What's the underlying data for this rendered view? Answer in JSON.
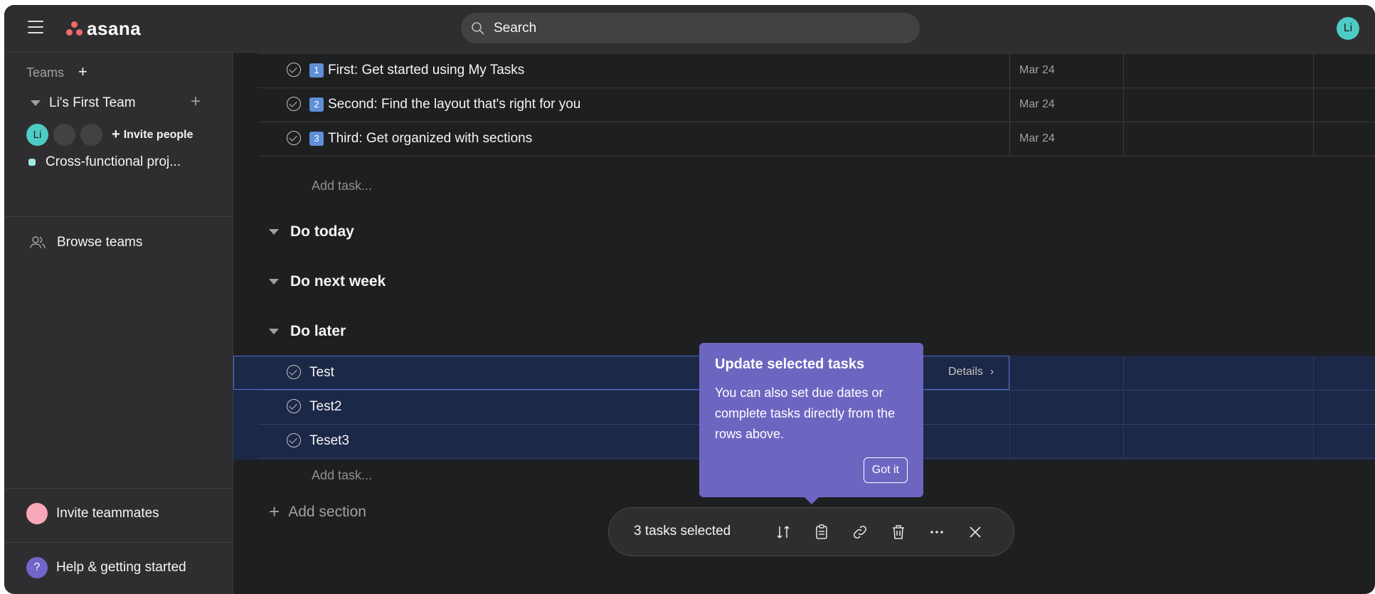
{
  "app": {
    "name": "asana"
  },
  "search": {
    "label": "Search"
  },
  "user": {
    "initials": "Li"
  },
  "sidebar": {
    "teams_label": "Teams",
    "team_name": "Li's First Team",
    "member_initials": "Li",
    "invite_people": "Invite people",
    "project_name": "Cross-functional proj...",
    "browse_teams": "Browse teams",
    "invite_teammates": "Invite teammates",
    "help": "Help & getting started",
    "help_icon": "?"
  },
  "tasks": [
    {
      "emoji": "1",
      "name": "First: Get started using My Tasks",
      "date": "Mar 24"
    },
    {
      "emoji": "2",
      "name": "Second: Find the layout that's right for you",
      "date": "Mar 24"
    },
    {
      "emoji": "3",
      "name": "Third: Get organized with sections",
      "date": "Mar 24"
    }
  ],
  "add_task": "Add task...",
  "sections": [
    "Do today",
    "Do next week",
    "Do later"
  ],
  "later_tasks": [
    {
      "name": "Test"
    },
    {
      "name": "Test2"
    },
    {
      "name": "Teset3"
    }
  ],
  "details_label": "Details",
  "add_section": "Add section",
  "tooltip": {
    "title": "Update selected tasks",
    "body": "You can also set due dates or complete tasks directly from the rows above.",
    "button": "Got it"
  },
  "action_bar": {
    "count_label": "3 tasks selected"
  },
  "colors": {
    "background": "#1e1f21",
    "sidebar": "#2e2e30",
    "accent": "#6d66c1",
    "selection": "#1c2848",
    "avatar": "#4ecbc4"
  }
}
